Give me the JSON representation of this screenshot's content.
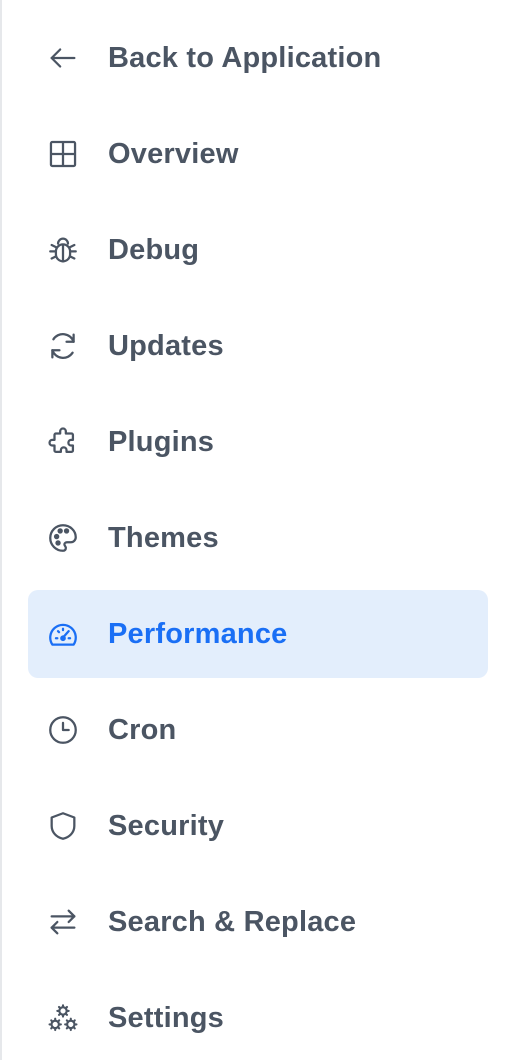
{
  "sidebar": {
    "items": [
      {
        "label": "Back to Application",
        "icon": "arrow-left-icon"
      },
      {
        "label": "Overview",
        "icon": "grid-icon"
      },
      {
        "label": "Debug",
        "icon": "bug-icon"
      },
      {
        "label": "Updates",
        "icon": "refresh-icon"
      },
      {
        "label": "Plugins",
        "icon": "puzzle-icon"
      },
      {
        "label": "Themes",
        "icon": "palette-icon"
      },
      {
        "label": "Performance",
        "icon": "speedometer-icon",
        "active": true
      },
      {
        "label": "Cron",
        "icon": "clock-icon"
      },
      {
        "label": "Security",
        "icon": "shield-icon"
      },
      {
        "label": "Search & Replace",
        "icon": "arrows-swap-icon"
      },
      {
        "label": "Settings",
        "icon": "cogs-icon"
      }
    ]
  },
  "colors": {
    "text": "#4b5563",
    "active_text": "#1a6ff5",
    "active_bg": "#e3eefc",
    "border": "#e6e8eb"
  }
}
